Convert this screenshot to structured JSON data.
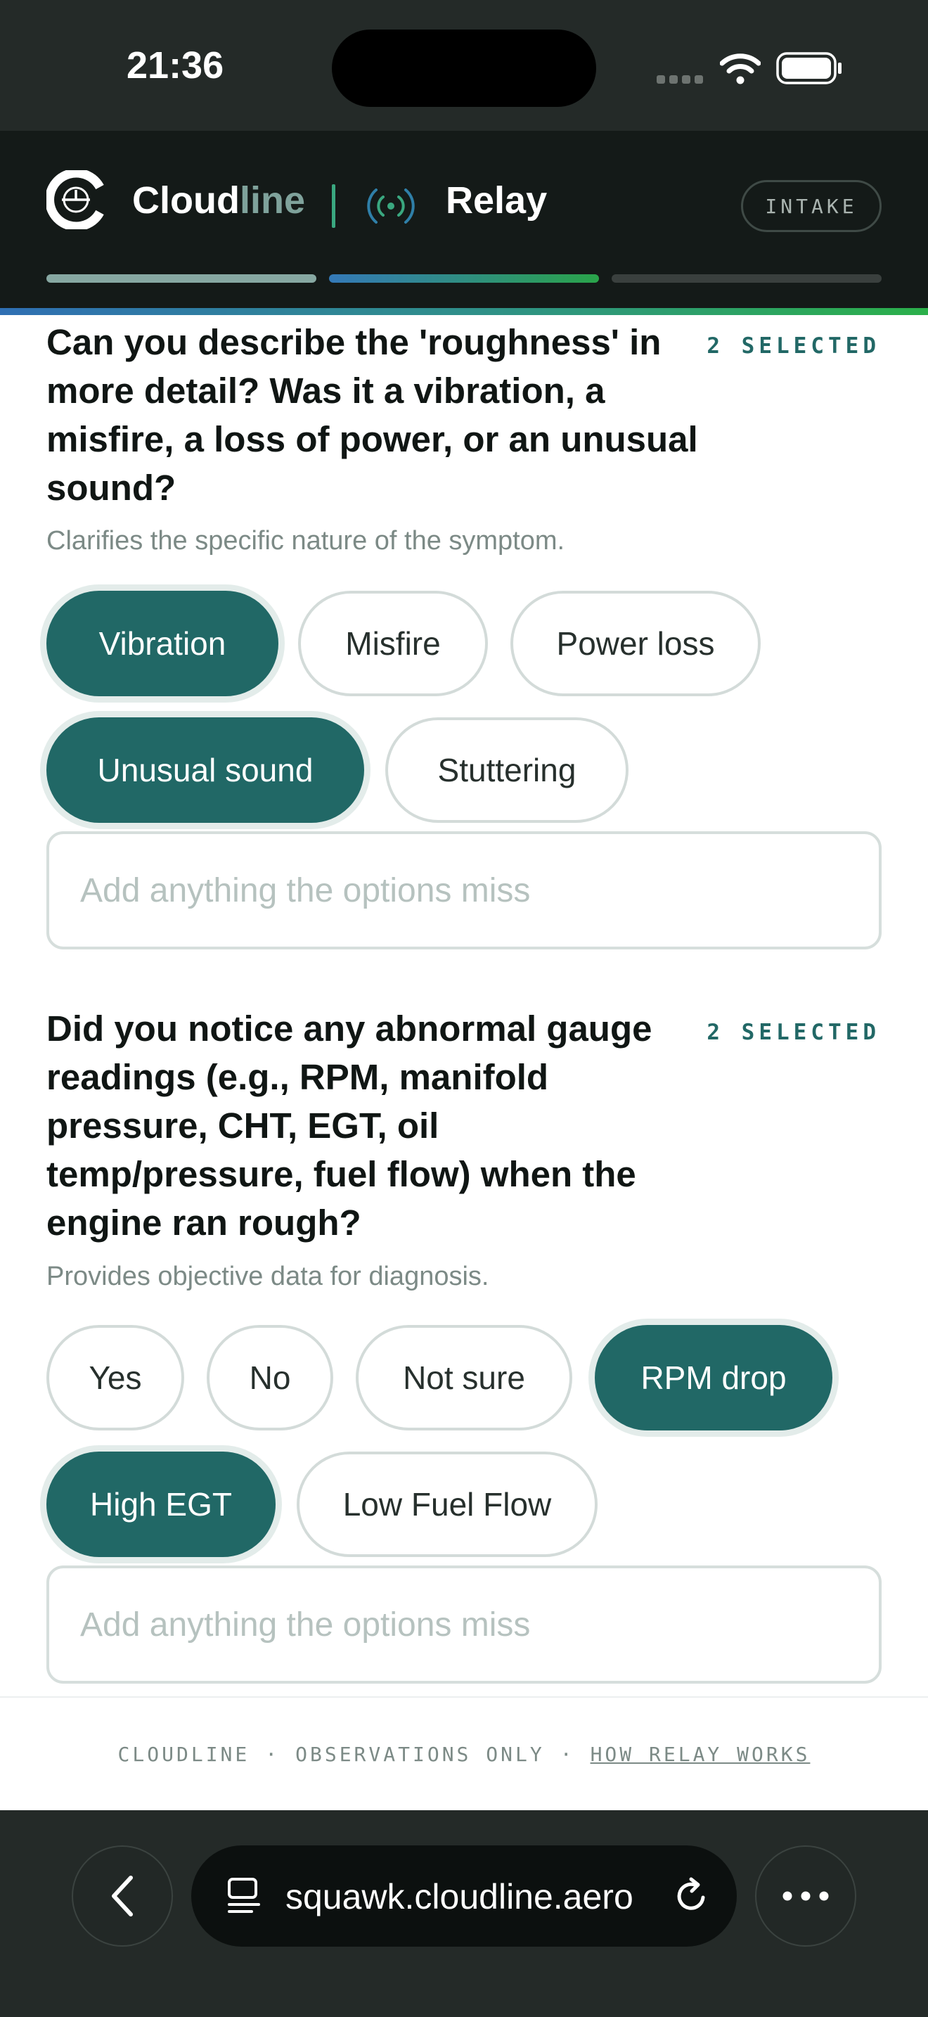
{
  "status_bar": {
    "time": "21:36"
  },
  "header": {
    "brand_primary": "Cloud",
    "brand_accent": "line",
    "product": "Relay",
    "badge": "INTAKE"
  },
  "progress": {
    "steps_total": 3,
    "current_step": 2
  },
  "questions": [
    {
      "text": "Can you describe the 'roughness' in more detail? Was it a vibration, a misfire, a loss of power, or an unusual sound?",
      "selected_label": "2 SELECTED",
      "hint": "Clarifies the specific nature of the symptom.",
      "options": [
        {
          "label": "Vibration",
          "selected": true
        },
        {
          "label": "Misfire",
          "selected": false
        },
        {
          "label": "Power loss",
          "selected": false
        },
        {
          "label": "Unusual sound",
          "selected": true
        },
        {
          "label": "Stuttering",
          "selected": false
        }
      ],
      "input_placeholder": "Add anything the options miss"
    },
    {
      "text": "Did you notice any abnormal gauge readings (e.g., RPM, manifold pressure, CHT, EGT, oil temp/pressure, fuel flow) when the engine ran rough?",
      "selected_label": "2 SELECTED",
      "hint": "Provides objective data for diagnosis.",
      "options": [
        {
          "label": "Yes",
          "selected": false
        },
        {
          "label": "No",
          "selected": false
        },
        {
          "label": "Not sure",
          "selected": false
        },
        {
          "label": "RPM drop",
          "selected": true
        },
        {
          "label": "High EGT",
          "selected": true
        },
        {
          "label": "Low Fuel Flow",
          "selected": false
        }
      ],
      "input_placeholder": "Add anything the options miss"
    }
  ],
  "footer": {
    "brand": "CLOUDLINE",
    "separator": "·",
    "note": "OBSERVATIONS ONLY",
    "link": "HOW RELAY WORKS"
  },
  "browser": {
    "url": "squawk.cloudline.aero"
  },
  "colors": {
    "accent": "#216866",
    "header_bg": "#141a18",
    "status_bg": "#242a28"
  }
}
